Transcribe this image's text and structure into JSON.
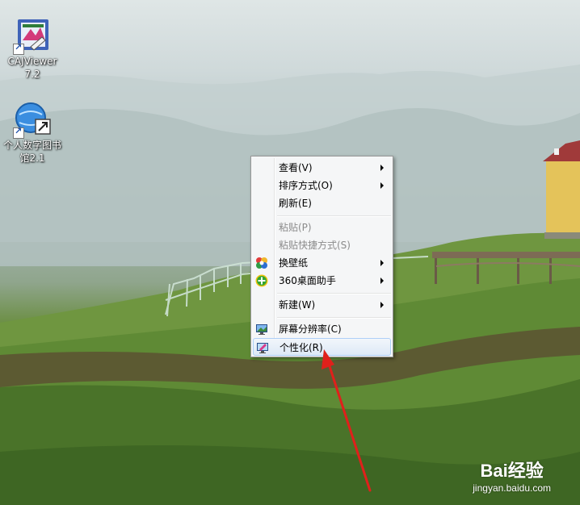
{
  "desktop": {
    "icons": [
      {
        "name": "cajviewer",
        "label_line1": "CAJViewer",
        "label_line2": "7.2"
      },
      {
        "name": "digital-library",
        "label_line1": "个人数字图书",
        "label_line2": "馆2.1"
      }
    ]
  },
  "context_menu": {
    "items": [
      {
        "label": "查看(V)",
        "submenu": true,
        "disabled": false
      },
      {
        "label": "排序方式(O)",
        "submenu": true,
        "disabled": false
      },
      {
        "label": "刷新(E)",
        "submenu": false,
        "disabled": false
      },
      {
        "label": "粘贴(P)",
        "submenu": false,
        "disabled": true
      },
      {
        "label": "粘贴快捷方式(S)",
        "submenu": false,
        "disabled": true
      },
      {
        "label": "换壁纸",
        "submenu": true,
        "disabled": false,
        "icon": "wallpaper-icon"
      },
      {
        "label": "360桌面助手",
        "submenu": true,
        "disabled": false,
        "icon": "360-assistant-icon"
      },
      {
        "label": "新建(W)",
        "submenu": true,
        "disabled": false
      },
      {
        "label": "屏幕分辨率(C)",
        "submenu": false,
        "disabled": false,
        "icon": "screen-resolution-icon"
      },
      {
        "label": "个性化(R)",
        "submenu": false,
        "disabled": false,
        "icon": "personalize-icon",
        "highlighted": true
      }
    ]
  },
  "watermark": {
    "brand": "Bai经验",
    "url": "jingyan.baidu.com"
  },
  "colors": {
    "annotation_arrow": "#e0201b",
    "menu_highlight_border": "#aecff7"
  }
}
